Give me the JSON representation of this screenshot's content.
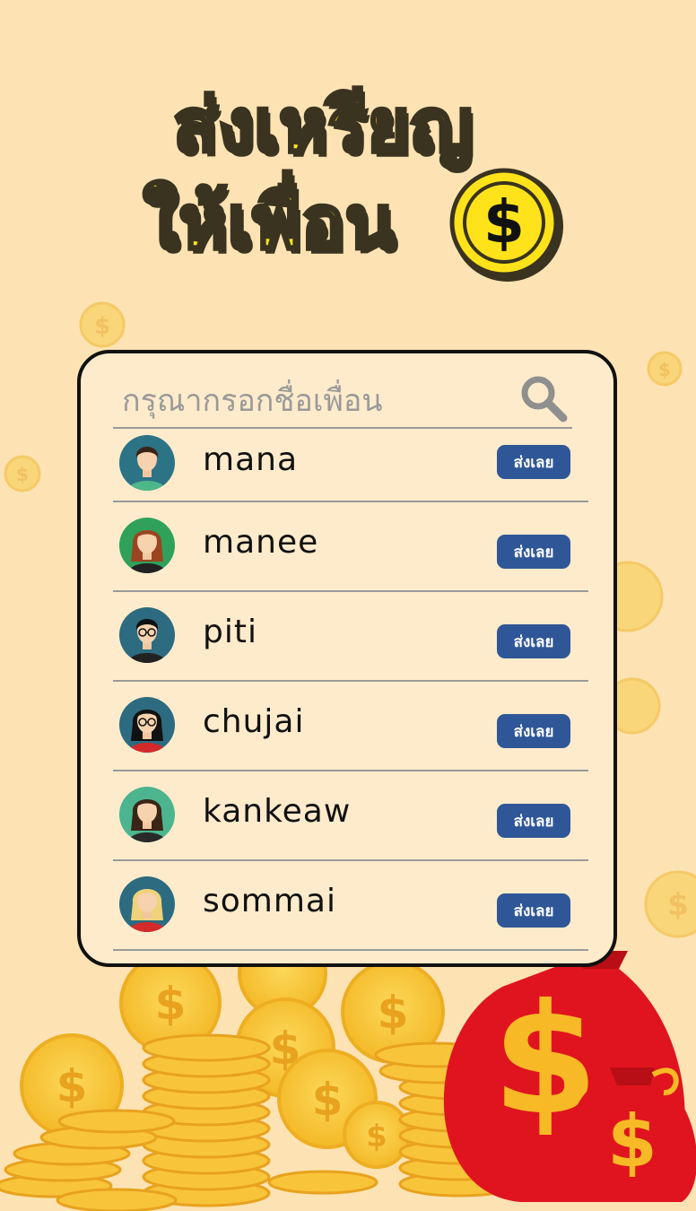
{
  "title": {
    "line1": "ส่งเหรียญ",
    "line2": "ให้เพื่อน",
    "coin_symbol": "$"
  },
  "search": {
    "placeholder": "กรุณากรอกชื่อเพื่อน",
    "icon": "search-icon"
  },
  "friends": [
    {
      "name": "mana",
      "button": "ส่งเลย",
      "avatar_bg": "#2c7385",
      "shirt": "#4cb889",
      "hair": "#3a2416",
      "gender": "male"
    },
    {
      "name": "manee",
      "button": "ส่งเลย",
      "avatar_bg": "#2fa15a",
      "shirt": "#222222",
      "hair": "#9a4520",
      "gender": "female"
    },
    {
      "name": "piti",
      "button": "ส่งเลย",
      "avatar_bg": "#2c6b80",
      "shirt": "#222222",
      "hair": "#111111",
      "gender": "male-glasses"
    },
    {
      "name": "chujai",
      "button": "ส่งเลย",
      "avatar_bg": "#2c6b80",
      "shirt": "#d42a2a",
      "hair": "#111111",
      "gender": "female-glasses"
    },
    {
      "name": "kankeaw",
      "button": "ส่งเลย",
      "avatar_bg": "#4cb58f",
      "shirt": "#2a2a2a",
      "hair": "#3a2416",
      "gender": "female-suit"
    },
    {
      "name": "sommai",
      "button": "ส่งเลย",
      "avatar_bg": "#2c6b80",
      "shirt": "#d42a2a",
      "hair": "#f0d27a",
      "gender": "female-blonde"
    }
  ],
  "colors": {
    "background": "#fde3b3",
    "card": "#fdebcb",
    "button": "#2f5797",
    "title": "#ffe21a",
    "coin": "#f7c531",
    "bag": "#e0141e"
  }
}
